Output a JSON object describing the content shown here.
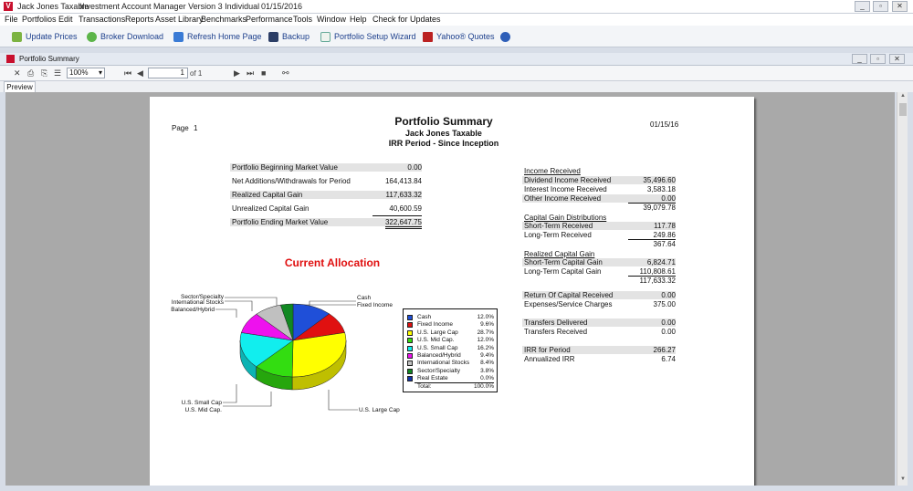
{
  "window": {
    "title_app": "Jack Jones Taxable",
    "title_product": "Investment Account Manager Version 3 Individual",
    "title_date": "01/15/2016"
  },
  "menu": [
    "File",
    "Portfolios",
    "Edit",
    "Transactions",
    "Reports",
    "Asset Library",
    "Benchmarks",
    "Performance",
    "Tools",
    "Window",
    "Help",
    "Check for Updates"
  ],
  "toolbar": {
    "update_prices": "Update Prices",
    "broker_download": "Broker Download",
    "refresh_home": "Refresh Home Page",
    "backup": "Backup",
    "setup_wizard": "Portfolio Setup Wizard",
    "yahoo_quotes": "Yahoo® Quotes"
  },
  "child_window": {
    "title": "Portfolio Summary"
  },
  "report_toolbar": {
    "zoom": "100%",
    "page_input": "1",
    "page_of": "of 1"
  },
  "tabs": {
    "preview": "Preview"
  },
  "report": {
    "page_label": "Page",
    "page_number": "1",
    "date": "01/15/16",
    "title": "Portfolio Summary",
    "subtitle": "Jack Jones Taxable",
    "period": "IRR Period - Since Inception",
    "summary": [
      {
        "label": "Portfolio Beginning Market Value",
        "value": "0.00"
      },
      {
        "label": "Net Additions/Withdrawals for Period",
        "value": "164,413.84"
      },
      {
        "label": "Realized Capital Gain",
        "value": "117,633.32"
      },
      {
        "label": "Unrealized Capital Gain",
        "value": "40,600.59"
      },
      {
        "label": "Portfolio Ending Market Value",
        "value": "322,647.75"
      }
    ],
    "income_header": "Income Received",
    "income": [
      {
        "label": "Dividend Income Received",
        "value": "35,496.60"
      },
      {
        "label": "Interest Income Received",
        "value": "3,583.18"
      },
      {
        "label": "Other Income Received",
        "value": "0.00"
      }
    ],
    "income_total": "39,079.78",
    "capgain_dist_header": "Capital Gain Distributions",
    "capgain_dist": [
      {
        "label": "Short-Term Received",
        "value": "117.78"
      },
      {
        "label": "Long-Term Received",
        "value": "249.86"
      }
    ],
    "capgain_dist_total": "367.64",
    "realized_header": "Realized Capital Gain",
    "realized": [
      {
        "label": "Short-Term Capital Gain",
        "value": "6,824.71"
      },
      {
        "label": "Long-Term Capital Gain",
        "value": "110,808.61"
      }
    ],
    "realized_total": "117,633.32",
    "other1": [
      {
        "label": "Return Of Capital Received",
        "value": "0.00"
      },
      {
        "label": "Expenses/Service Charges",
        "value": "375.00"
      }
    ],
    "other2": [
      {
        "label": "Transfers Delivered",
        "value": "0.00"
      },
      {
        "label": "Transfers Received",
        "value": "0.00"
      }
    ],
    "other3": [
      {
        "label": "IRR for Period",
        "value": "266.27"
      },
      {
        "label": "Annualized IRR",
        "value": "6.74"
      }
    ],
    "allocation_title": "Current Allocation",
    "legend_total_label": "Total:",
    "legend_total_value": "100.0%"
  },
  "chart_data": {
    "type": "pie",
    "title": "Current Allocation",
    "slices": [
      {
        "name": "Cash",
        "value": 12.0,
        "label": "12.0%",
        "color": "#1f4fd8"
      },
      {
        "name": "Fixed Income",
        "value": 9.6,
        "label": "9.6%",
        "color": "#e01010"
      },
      {
        "name": "U.S. Large Cap",
        "value": 28.7,
        "label": "28.7%",
        "color": "#ffff00"
      },
      {
        "name": "U.S. Mid Cap.",
        "value": 12.0,
        "label": "12.0%",
        "color": "#33dd11"
      },
      {
        "name": "U.S. Small Cap",
        "value": 16.2,
        "label": "16.2%",
        "color": "#11eeee"
      },
      {
        "name": "Balanced/Hybrid",
        "value": 9.4,
        "label": "9.4%",
        "color": "#ee11ee"
      },
      {
        "name": "International Stocks",
        "value": 8.4,
        "label": "8.4%",
        "color": "#c0c0c0"
      },
      {
        "name": "Sector/Specialty",
        "value": 3.8,
        "label": "3.8%",
        "color": "#118822"
      },
      {
        "name": "Real Estate",
        "value": 0.0,
        "label": "0.0%",
        "color": "#1133aa"
      }
    ],
    "callouts": {
      "cash": "Cash",
      "fixed": "Fixed Income",
      "sector": "Sector/Specialty",
      "intl": "International Stocks",
      "balanced": "Balanced/Hybrid",
      "small": "U.S. Small Cap",
      "mid": "U.S. Mid Cap.",
      "large": "U.S. Large Cap"
    }
  }
}
